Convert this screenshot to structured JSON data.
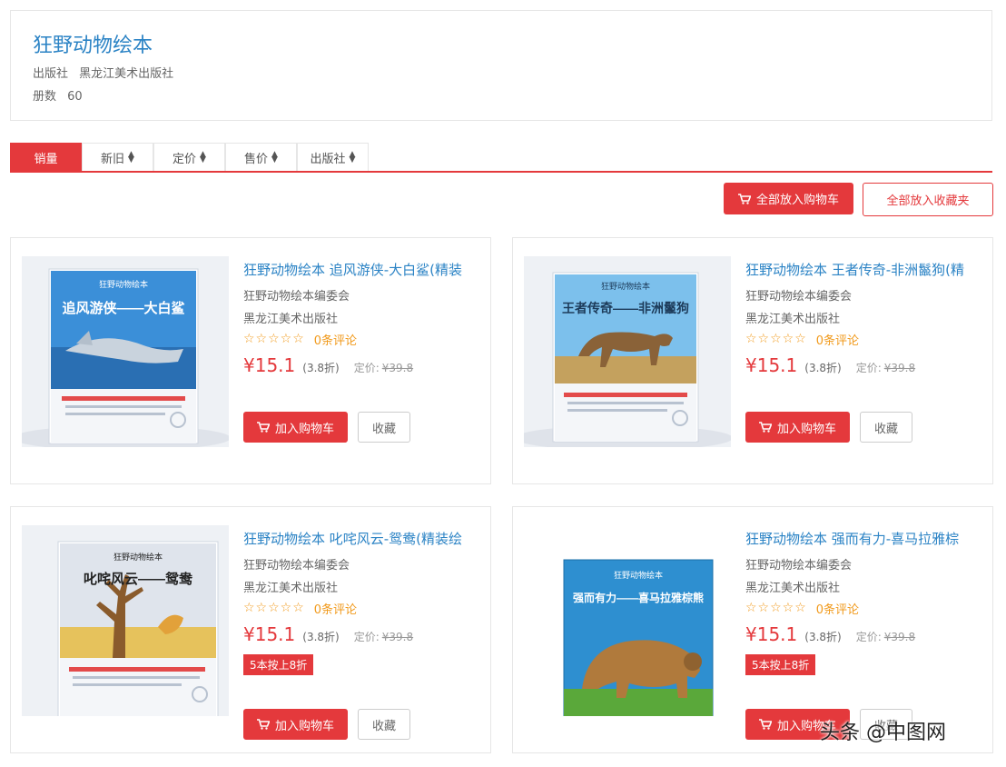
{
  "header": {
    "series_title": "狂野动物绘本",
    "publisher_label": "出版社",
    "publisher_value": "黑龙江美术出版社",
    "count_label": "册数",
    "count_value": "60"
  },
  "sort_tabs": [
    {
      "label": "销量",
      "active": true
    },
    {
      "label": "新旧",
      "active": false
    },
    {
      "label": "定价",
      "active": false
    },
    {
      "label": "售价",
      "active": false
    },
    {
      "label": "出版社",
      "active": false
    }
  ],
  "actions": {
    "add_all_cart": "全部放入购物车",
    "add_all_fav": "全部放入收藏夹"
  },
  "products": [
    {
      "title": "狂野动物绘本 追风游侠-大白鲨(精装",
      "author": "狂野动物绘本编委会",
      "publisher": "黑龙江美术出版社",
      "stars": "☆☆☆☆☆",
      "reviews": "0条评论",
      "price": "¥15.1",
      "discount": "(3.8折)",
      "list_price_label": "定价:",
      "list_price": "¥39.8",
      "promo": "",
      "cart_label": "加入购物车",
      "fav_label": "收藏",
      "cover": {
        "top_text": "狂野动物绘本",
        "main_text": "追风游侠——大白鲨",
        "bg": "#3b8fd8",
        "animal": "shark"
      }
    },
    {
      "title": "狂野动物绘本 王者传奇-非洲鬣狗(精",
      "author": "狂野动物绘本编委会",
      "publisher": "黑龙江美术出版社",
      "stars": "☆☆☆☆☆",
      "reviews": "0条评论",
      "price": "¥15.1",
      "discount": "(3.8折)",
      "list_price_label": "定价:",
      "list_price": "¥39.8",
      "promo": "",
      "cart_label": "加入购物车",
      "fav_label": "收藏",
      "cover": {
        "top_text": "狂野动物绘本",
        "main_text": "王者传奇——非洲鬣狗",
        "bg": "#6cb4e6",
        "animal": "hyena"
      }
    },
    {
      "title": "狂野动物绘本 叱咤风云-鸳鸯(精装绘",
      "author": "狂野动物绘本编委会",
      "publisher": "黑龙江美术出版社",
      "stars": "☆☆☆☆☆",
      "reviews": "0条评论",
      "price": "¥15.1",
      "discount": "(3.8折)",
      "list_price_label": "定价:",
      "list_price": "¥39.8",
      "promo": "5本按上8折",
      "cart_label": "加入购物车",
      "fav_label": "收藏",
      "cover": {
        "top_text": "狂野动物绘本",
        "main_text": "叱咤风云——鸳鸯",
        "bg": "#d8dde8",
        "animal": "tree"
      }
    },
    {
      "title": "狂野动物绘本 强而有力-喜马拉雅棕",
      "author": "狂野动物绘本编委会",
      "publisher": "黑龙江美术出版社",
      "stars": "☆☆☆☆☆",
      "reviews": "0条评论",
      "price": "¥15.1",
      "discount": "(3.8折)",
      "list_price_label": "定价:",
      "list_price": "¥39.8",
      "promo": "5本按上8折",
      "cart_label": "加入购物车",
      "fav_label": "收藏",
      "cover": {
        "top_text": "狂野动物绘本",
        "main_text": "强而有力——喜马拉雅棕熊",
        "bg": "#2e8fd0",
        "animal": "bear"
      }
    }
  ],
  "watermark": "头条 @中图网",
  "colors": {
    "accent": "#e4393c",
    "link": "#2b83c5",
    "star": "#f19a1c"
  }
}
